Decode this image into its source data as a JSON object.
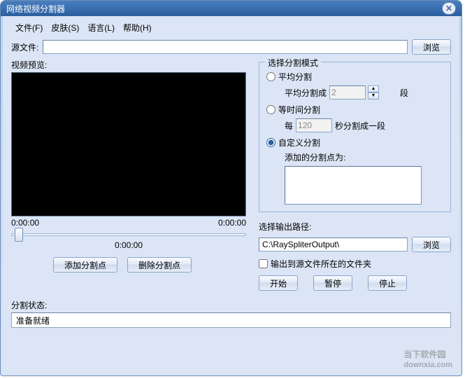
{
  "window": {
    "title": "网络视频分割器"
  },
  "menu": {
    "file": "文件(F)",
    "skin": "皮肤(S)",
    "lang": "语言(L)",
    "help": "帮助(H)"
  },
  "source": {
    "label": "源文件:",
    "value": "",
    "browse": "浏览"
  },
  "preview": {
    "label": "视频预览:",
    "time_start": "0:00:00",
    "time_end": "0:00:00",
    "time_pos": "0:00:00"
  },
  "buttons": {
    "add_point": "添加分割点",
    "del_point": "删除分割点",
    "start": "开始",
    "pause": "暂停",
    "stop": "停止"
  },
  "split_mode": {
    "legend": "选择分割模式",
    "avg_label": "平均分割",
    "avg_sub_prefix": "平均分割成",
    "avg_value": "2",
    "avg_sub_suffix": "段",
    "time_label": "等时间分割",
    "time_sub_prefix": "每",
    "time_value": "120",
    "time_sub_suffix": "秒分割成一段",
    "custom_label": "自定义分割",
    "custom_sub": "添加的分割点为:"
  },
  "output": {
    "label": "选择输出路径:",
    "path": "C:\\RaySpliterOutput\\",
    "browse": "浏览",
    "checkbox_label": "输出到源文件所在的文件夹"
  },
  "status": {
    "label": "分割状态:",
    "value": "准备就绪"
  },
  "watermark": {
    "line1": "当下软件园",
    "line2": "downxia.com"
  }
}
